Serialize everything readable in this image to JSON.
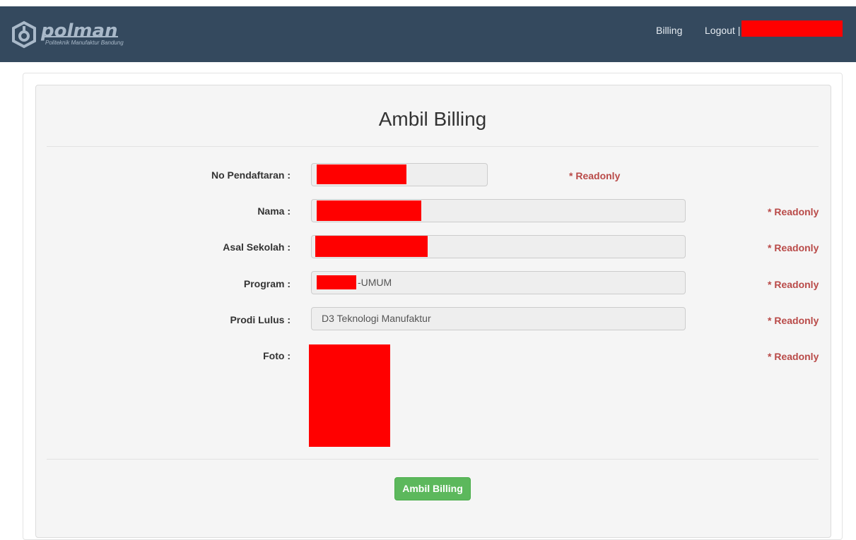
{
  "header": {
    "logo_text": "polman",
    "logo_subtitle": "Politeknik Manufaktur Bandung",
    "nav_billing": "Billing",
    "nav_logout": "Logout |",
    "bg_color": "#34495e"
  },
  "form": {
    "title": "Ambil Billing",
    "readonly_note": "* Readonly",
    "fields": {
      "no_pendaftaran": {
        "label": "No Pendaftaran :",
        "value": ""
      },
      "nama": {
        "label": "Nama :",
        "value": ""
      },
      "asal_sekolah": {
        "label": "Asal Sekolah :",
        "value": ""
      },
      "program": {
        "label": "Program :",
        "value_suffix": "-UMUM"
      },
      "prodi_lulus": {
        "label": "Prodi Lulus :",
        "value": "D3 Teknologi Manufaktur"
      },
      "foto": {
        "label": "Foto :"
      }
    },
    "submit_label": "Ambil Billing",
    "button_color": "#5cb85c",
    "readonly_color": "#b94a48"
  }
}
